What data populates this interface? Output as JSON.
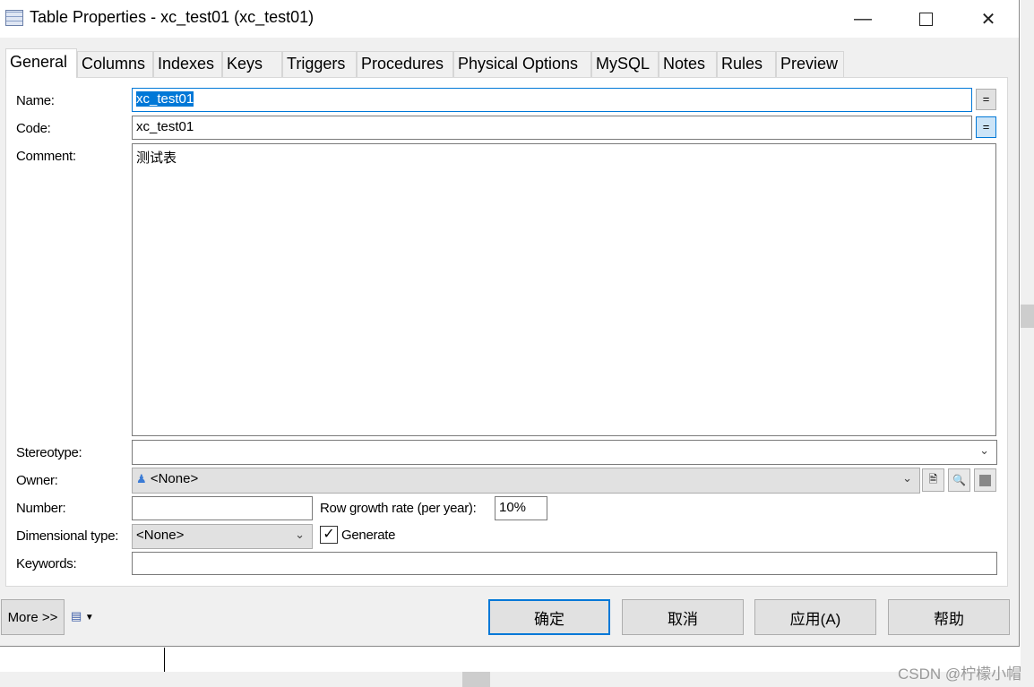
{
  "window": {
    "title": "Table Properties - xc_test01 (xc_test01)",
    "icon": "table-icon",
    "controls": [
      "minimize",
      "maximize",
      "close"
    ]
  },
  "tabs": [
    {
      "label": "General",
      "selected": true
    },
    {
      "label": "Columns"
    },
    {
      "label": "Indexes"
    },
    {
      "label": "Keys"
    },
    {
      "label": "Triggers"
    },
    {
      "label": "Procedures"
    },
    {
      "label": "Physical Options"
    },
    {
      "label": "MySQL"
    },
    {
      "label": "Notes"
    },
    {
      "label": "Rules"
    },
    {
      "label": "Preview"
    }
  ],
  "form": {
    "name_label": "Name:",
    "name_value": "xc_test01",
    "code_label": "Code:",
    "code_value": "xc_test01",
    "eq_label": "=",
    "comment_label": "Comment:",
    "comment_value": "测试表",
    "stereotype_label": "Stereotype:",
    "stereotype_value": "",
    "owner_label": "Owner:",
    "owner_value": "<None>",
    "number_label": "Number:",
    "number_value": "",
    "growth_label": "Row growth rate (per year):",
    "growth_value": "10%",
    "dimensional_label": "Dimensional type:",
    "dimensional_value": "<None>",
    "generate_label": "Generate",
    "generate_checked": true,
    "keywords_label": "Keywords:",
    "keywords_value": ""
  },
  "footer": {
    "more": "More >>",
    "ok": "确定",
    "cancel": "取消",
    "apply": "应用(A)",
    "help": "帮助"
  },
  "watermark": "CSDN @柠檬小帽",
  "colors": {
    "accent": "#0078d7",
    "selection": "#0078d7"
  }
}
